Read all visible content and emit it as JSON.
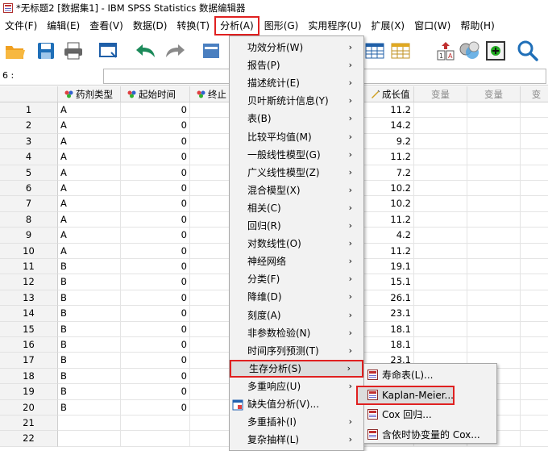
{
  "window": {
    "title": "*无标题2 [数据集1] - IBM SPSS Statistics 数据编辑器"
  },
  "menubar": [
    {
      "label": "文件(F)",
      "active": false
    },
    {
      "label": "编辑(E)",
      "active": false
    },
    {
      "label": "查看(V)",
      "active": false
    },
    {
      "label": "数据(D)",
      "active": false
    },
    {
      "label": "转换(T)",
      "active": false
    },
    {
      "label": "分析(A)",
      "active": true
    },
    {
      "label": "图形(G)",
      "active": false
    },
    {
      "label": "实用程序(U)",
      "active": false
    },
    {
      "label": "扩展(X)",
      "active": false
    },
    {
      "label": "窗口(W)",
      "active": false
    },
    {
      "label": "帮助(H)",
      "active": false
    }
  ],
  "cell_ref": "6 :",
  "columns": {
    "type": "药剂类型",
    "start": "起始时间",
    "end": "终止",
    "grow": "成长值",
    "var1": "变量",
    "var2": "变量",
    "var3": "变"
  },
  "rows": [
    {
      "n": "1",
      "type": "A",
      "start": "0",
      "grow": "11.2"
    },
    {
      "n": "2",
      "type": "A",
      "start": "0",
      "grow": "14.2"
    },
    {
      "n": "3",
      "type": "A",
      "start": "0",
      "grow": "9.2"
    },
    {
      "n": "4",
      "type": "A",
      "start": "0",
      "grow": "11.2"
    },
    {
      "n": "5",
      "type": "A",
      "start": "0",
      "grow": "7.2"
    },
    {
      "n": "6",
      "type": "A",
      "start": "0",
      "grow": "10.2"
    },
    {
      "n": "7",
      "type": "A",
      "start": "0",
      "grow": "10.2"
    },
    {
      "n": "8",
      "type": "A",
      "start": "0",
      "grow": "11.2"
    },
    {
      "n": "9",
      "type": "A",
      "start": "0",
      "grow": "4.2"
    },
    {
      "n": "10",
      "type": "A",
      "start": "0",
      "grow": "11.2"
    },
    {
      "n": "11",
      "type": "B",
      "start": "0",
      "grow": "19.1"
    },
    {
      "n": "12",
      "type": "B",
      "start": "0",
      "grow": "15.1"
    },
    {
      "n": "13",
      "type": "B",
      "start": "0",
      "grow": "26.1"
    },
    {
      "n": "14",
      "type": "B",
      "start": "0",
      "grow": "23.1"
    },
    {
      "n": "15",
      "type": "B",
      "start": "0",
      "grow": "18.1"
    },
    {
      "n": "16",
      "type": "B",
      "start": "0",
      "grow": "18.1"
    },
    {
      "n": "17",
      "type": "B",
      "start": "0",
      "grow": "23.1"
    },
    {
      "n": "18",
      "type": "B",
      "start": "0",
      "grow": ""
    },
    {
      "n": "19",
      "type": "B",
      "start": "0",
      "grow": ""
    },
    {
      "n": "20",
      "type": "B",
      "start": "0",
      "grow": ""
    },
    {
      "n": "21",
      "type": "",
      "start": "",
      "grow": ""
    },
    {
      "n": "22",
      "type": "",
      "start": "",
      "grow": ""
    }
  ],
  "analyze_menu": [
    {
      "label": "功效分析(W)",
      "sub": true
    },
    {
      "label": "报告(P)",
      "sub": true
    },
    {
      "label": "描述统计(E)",
      "sub": true
    },
    {
      "label": "贝叶斯统计信息(Y)",
      "sub": true
    },
    {
      "label": "表(B)",
      "sub": true
    },
    {
      "label": "比较平均值(M)",
      "sub": true
    },
    {
      "label": "一般线性模型(G)",
      "sub": true
    },
    {
      "label": "广义线性模型(Z)",
      "sub": true
    },
    {
      "label": "混合模型(X)",
      "sub": true
    },
    {
      "label": "相关(C)",
      "sub": true
    },
    {
      "label": "回归(R)",
      "sub": true
    },
    {
      "label": "对数线性(O)",
      "sub": true
    },
    {
      "label": "神经网络",
      "sub": true
    },
    {
      "label": "分类(F)",
      "sub": true
    },
    {
      "label": "降维(D)",
      "sub": true
    },
    {
      "label": "刻度(A)",
      "sub": true
    },
    {
      "label": "非参数检验(N)",
      "sub": true
    },
    {
      "label": "时间序列预测(T)",
      "sub": true
    },
    {
      "label": "生存分析(S)",
      "sub": true,
      "selected": true
    },
    {
      "label": "多重响应(U)",
      "sub": true
    },
    {
      "label": "缺失值分析(V)...",
      "sub": false,
      "icon": true
    },
    {
      "label": "多重插补(I)",
      "sub": true
    },
    {
      "label": "复杂抽样(L)",
      "sub": true
    }
  ],
  "survival_submenu": [
    {
      "label": "寿命表(L)..."
    },
    {
      "label": "Kaplan-Meier...",
      "selected": true
    },
    {
      "label": "Cox 回归..."
    },
    {
      "label": "含依时协变量的 Cox..."
    }
  ],
  "colors": {
    "highlight_border": "#e02020",
    "menu_bg": "#f2f2f2",
    "header_bg": "#f3f3f3"
  }
}
